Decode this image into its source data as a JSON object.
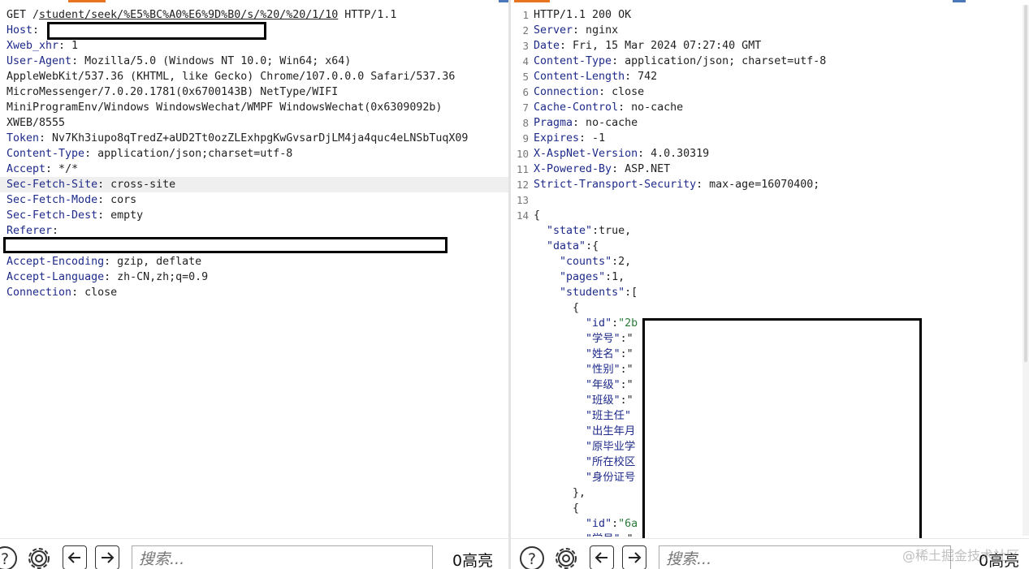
{
  "request": {
    "lines": [
      {
        "segs": [
          {
            "t": "GET /"
          },
          {
            "t": "student/seek/%E5%BC%A0%E6%9D%B0/s/%20/%20/1/10",
            "u": true
          },
          {
            "t": " HTTP/1.1"
          }
        ]
      },
      {
        "segs": [
          {
            "t": "Host",
            "k": true
          },
          {
            "t": ": "
          }
        ]
      },
      {
        "segs": [
          {
            "t": "Xweb_xhr",
            "k": true
          },
          {
            "t": ": 1"
          }
        ]
      },
      {
        "segs": [
          {
            "t": "User-Agent",
            "k": true
          },
          {
            "t": ": Mozilla/5.0 (Windows NT 10.0; Win64; x64)"
          }
        ]
      },
      {
        "segs": [
          {
            "t": "AppleWebKit/537.36 (KHTML, like Gecko) Chrome/107.0.0.0 Safari/537.36"
          }
        ]
      },
      {
        "segs": [
          {
            "t": "MicroMessenger/7.0.20.1781(0x6700143B) NetType/WIFI"
          }
        ]
      },
      {
        "segs": [
          {
            "t": "MiniProgramEnv/Windows WindowsWechat/WMPF WindowsWechat(0x6309092b)"
          }
        ]
      },
      {
        "segs": [
          {
            "t": "XWEB/8555"
          }
        ]
      },
      {
        "segs": [
          {
            "t": "Token",
            "k": true
          },
          {
            "t": ": Nv7Kh3iupo8qTredZ+aUD2Tt0ozZLExhpgKwGvsarDjLM4ja4quc4eLNSbTuqX09"
          }
        ]
      },
      {
        "segs": [
          {
            "t": "Content-Type",
            "k": true
          },
          {
            "t": ": application/json;charset=utf-8"
          }
        ]
      },
      {
        "segs": [
          {
            "t": "Accept",
            "k": true
          },
          {
            "t": ": */*"
          }
        ]
      },
      {
        "segs": [
          {
            "t": "Sec-Fetch-Site",
            "k": true
          },
          {
            "t": ": cross-site"
          }
        ],
        "hl": true
      },
      {
        "segs": [
          {
            "t": "Sec-Fetch-Mode",
            "k": true
          },
          {
            "t": ": cors"
          }
        ]
      },
      {
        "segs": [
          {
            "t": "Sec-Fetch-Dest",
            "k": true
          },
          {
            "t": ": empty"
          }
        ]
      },
      {
        "segs": [
          {
            "t": "Referer",
            "k": true
          },
          {
            "t": ":"
          }
        ]
      },
      {
        "segs": [
          {
            "t": ""
          }
        ]
      },
      {
        "segs": [
          {
            "t": "Accept-Encoding",
            "k": true
          },
          {
            "t": ": gzip, deflate"
          }
        ]
      },
      {
        "segs": [
          {
            "t": "Accept-Language",
            "k": true
          },
          {
            "t": ": zh-CN,zh;q=0.9"
          }
        ]
      },
      {
        "segs": [
          {
            "t": "Connection",
            "k": true
          },
          {
            "t": ": close"
          }
        ]
      }
    ]
  },
  "response": {
    "lines": [
      {
        "n": "1",
        "segs": [
          {
            "t": "HTTP/1.1 200 OK"
          }
        ]
      },
      {
        "n": "2",
        "segs": [
          {
            "t": "Server",
            "k": true
          },
          {
            "t": ": nginx"
          }
        ]
      },
      {
        "n": "3",
        "segs": [
          {
            "t": "Date",
            "k": true
          },
          {
            "t": ": Fri, 15 Mar 2024 07:27:40 GMT"
          }
        ]
      },
      {
        "n": "4",
        "segs": [
          {
            "t": "Content-Type",
            "k": true
          },
          {
            "t": ": application/json; charset=utf-8"
          }
        ]
      },
      {
        "n": "5",
        "segs": [
          {
            "t": "Content-Length",
            "k": true
          },
          {
            "t": ": 742"
          }
        ]
      },
      {
        "n": "6",
        "segs": [
          {
            "t": "Connection",
            "k": true
          },
          {
            "t": ": close"
          }
        ]
      },
      {
        "n": "7",
        "segs": [
          {
            "t": "Cache-Control",
            "k": true
          },
          {
            "t": ": no-cache"
          }
        ]
      },
      {
        "n": "8",
        "segs": [
          {
            "t": "Pragma",
            "k": true
          },
          {
            "t": ": no-cache"
          }
        ]
      },
      {
        "n": "9",
        "segs": [
          {
            "t": "Expires",
            "k": true
          },
          {
            "t": ": -1"
          }
        ]
      },
      {
        "n": "10",
        "segs": [
          {
            "t": "X-AspNet-Version",
            "k": true
          },
          {
            "t": ": 4.0.30319"
          }
        ]
      },
      {
        "n": "11",
        "segs": [
          {
            "t": "X-Powered-By",
            "k": true
          },
          {
            "t": ": ASP.NET"
          }
        ]
      },
      {
        "n": "12",
        "segs": [
          {
            "t": "Strict-Transport-Security",
            "k": true
          },
          {
            "t": ": max-age=16070400;"
          }
        ]
      },
      {
        "n": "13",
        "segs": [
          {
            "t": ""
          }
        ]
      },
      {
        "n": "14",
        "segs": [
          {
            "t": "{"
          }
        ]
      },
      {
        "n": "",
        "segs": [
          {
            "t": "  "
          },
          {
            "t": "\"state\"",
            "s": true
          },
          {
            "t": ":true,"
          }
        ]
      },
      {
        "n": "",
        "segs": [
          {
            "t": "  "
          },
          {
            "t": "\"data\"",
            "s": true
          },
          {
            "t": ":{"
          }
        ]
      },
      {
        "n": "",
        "segs": [
          {
            "t": "    "
          },
          {
            "t": "\"counts\"",
            "s": true
          },
          {
            "t": ":2,"
          }
        ]
      },
      {
        "n": "",
        "segs": [
          {
            "t": "    "
          },
          {
            "t": "\"pages\"",
            "s": true
          },
          {
            "t": ":1,"
          }
        ]
      },
      {
        "n": "",
        "segs": [
          {
            "t": "    "
          },
          {
            "t": "\"students\"",
            "s": true
          },
          {
            "t": ":["
          }
        ]
      },
      {
        "n": "",
        "segs": [
          {
            "t": "      {"
          }
        ]
      },
      {
        "n": "",
        "segs": [
          {
            "t": "        "
          },
          {
            "t": "\"id\"",
            "s": true
          },
          {
            "t": ":"
          },
          {
            "t": "\"2b",
            "g": true
          }
        ]
      },
      {
        "n": "",
        "segs": [
          {
            "t": "        "
          },
          {
            "t": "\"学号\"",
            "s": true
          },
          {
            "t": ":\""
          }
        ]
      },
      {
        "n": "",
        "segs": [
          {
            "t": "        "
          },
          {
            "t": "\"姓名\"",
            "s": true
          },
          {
            "t": ":\""
          }
        ]
      },
      {
        "n": "",
        "segs": [
          {
            "t": "        "
          },
          {
            "t": "\"性别\"",
            "s": true
          },
          {
            "t": ":\""
          }
        ]
      },
      {
        "n": "",
        "segs": [
          {
            "t": "        "
          },
          {
            "t": "\"年级\"",
            "s": true
          },
          {
            "t": ":\""
          }
        ]
      },
      {
        "n": "",
        "segs": [
          {
            "t": "        "
          },
          {
            "t": "\"班级\"",
            "s": true
          },
          {
            "t": ":\""
          }
        ]
      },
      {
        "n": "",
        "segs": [
          {
            "t": "        "
          },
          {
            "t": "\"班主任\"",
            "s": true
          }
        ]
      },
      {
        "n": "",
        "segs": [
          {
            "t": "        "
          },
          {
            "t": "\"出生年月",
            "s": true
          }
        ]
      },
      {
        "n": "",
        "segs": [
          {
            "t": "        "
          },
          {
            "t": "\"原毕业学",
            "s": true
          }
        ]
      },
      {
        "n": "",
        "segs": [
          {
            "t": "        "
          },
          {
            "t": "\"所在校区",
            "s": true
          }
        ]
      },
      {
        "n": "",
        "segs": [
          {
            "t": "        "
          },
          {
            "t": "\"身份证号",
            "s": true
          }
        ]
      },
      {
        "n": "",
        "segs": [
          {
            "t": "      },"
          }
        ]
      },
      {
        "n": "",
        "segs": [
          {
            "t": "      {"
          }
        ]
      },
      {
        "n": "",
        "segs": [
          {
            "t": "        "
          },
          {
            "t": "\"id\"",
            "s": true
          },
          {
            "t": ":"
          },
          {
            "t": "\"6a",
            "g": true
          }
        ]
      },
      {
        "n": "",
        "segs": [
          {
            "t": "        "
          },
          {
            "t": "\"学号\"",
            "s": true
          },
          {
            "t": ":\""
          }
        ]
      }
    ]
  },
  "toolbar": {
    "search_placeholder": "搜索...",
    "left_hits": "0高亮",
    "right_hits": "0高亮"
  },
  "watermark": "@稀土掘金技术社区",
  "icons": [
    "help-icon",
    "gear-icon",
    "arrow-left-icon",
    "arrow-right-icon"
  ],
  "colors": {
    "key": "#1e2a8a",
    "accent": "#e8741f",
    "value_green": "#2a7a3a"
  }
}
